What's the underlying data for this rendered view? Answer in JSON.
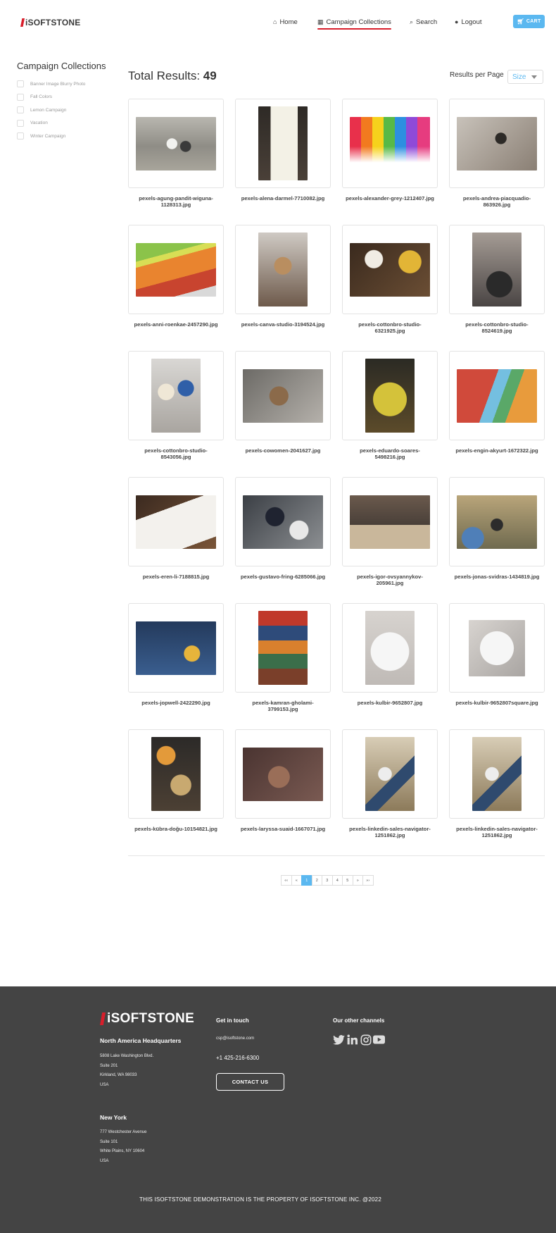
{
  "brand": {
    "name": "iSoftStone",
    "accent": "#d81e2b",
    "primary": "#5bb8f0",
    "footer_bg": "#444444"
  },
  "nav": {
    "home": "Home",
    "collections": "Campaign Collections",
    "search": "Search",
    "logout": "Logout",
    "cart": "CART",
    "icons": {
      "home": "home-icon",
      "collections": "collections-icon",
      "search": "search-icon",
      "logout": "user-icon",
      "cart": "cart-icon"
    }
  },
  "sidebar": {
    "title": "Campaign Collections",
    "filters": [
      "Banner Image Blurry Photo",
      "Fall Colors",
      "Lemon Campaign",
      "Vacation",
      "Winter Campaign"
    ]
  },
  "results": {
    "label": "Total Results:",
    "count": "49",
    "per_page_label": "Results per Page",
    "per_page_placeholder": "Size"
  },
  "items": [
    {
      "name": "pexels-agung-pandit-wiguna-1128313.jpg"
    },
    {
      "name": "pexels-alena-darmel-7710082.jpg"
    },
    {
      "name": "pexels-alexander-grey-1212407.jpg"
    },
    {
      "name": "pexels-andrea-piacquadio-863926.jpg"
    },
    {
      "name": "pexels-anni-roenkae-2457290.jpg"
    },
    {
      "name": "pexels-canva-studio-3194524.jpg"
    },
    {
      "name": "pexels-cottonbro-studio-6321925.jpg"
    },
    {
      "name": "pexels-cottonbro-studio-8524619.jpg"
    },
    {
      "name": "pexels-cottonbro-studio-8543056.jpg"
    },
    {
      "name": "pexels-cowomen-2041627.jpg"
    },
    {
      "name": "pexels-eduardo-soares-5498216.jpg"
    },
    {
      "name": "pexels-engin-akyurt-1672322.jpg"
    },
    {
      "name": "pexels-eren-li-7188815.jpg"
    },
    {
      "name": "pexels-gustavo-fring-6285066.jpg"
    },
    {
      "name": "pexels-igor-ovsyannykov-205961.jpg"
    },
    {
      "name": "pexels-jonas-svidras-1434819.jpg"
    },
    {
      "name": "pexels-jopwell-2422290.jpg"
    },
    {
      "name": "pexels-kamran-gholami-3799153.jpg"
    },
    {
      "name": "pexels-kulbir-9652807.jpg"
    },
    {
      "name": "pexels-kulbir-9652807square.jpg"
    },
    {
      "name": "pexels-kübra-doğu-10154821.jpg"
    },
    {
      "name": "pexels-laryssa-suaid-1667071.jpg"
    },
    {
      "name": "pexels-linkedin-sales-navigator-1251862.jpg"
    },
    {
      "name": "pexels-linkedin-sales-navigator-1251862.jpg"
    }
  ],
  "pagination": {
    "first": "«‹",
    "prev": "«",
    "pages": [
      "1",
      "2",
      "3",
      "4",
      "5"
    ],
    "current": "1",
    "next": "»",
    "last": "»›"
  },
  "footer": {
    "hq_title": "North America Headquarters",
    "hq_address": [
      "5808 Lake Washington Blvd.",
      "Suite 201",
      "Kirkland, WA 98033",
      "USA"
    ],
    "ny_title": "New York",
    "ny_address": [
      "777 Westchester Avenue",
      "Suite 101",
      "White Plains, NY 10604",
      "USA"
    ],
    "get_in_touch": "Get in touch",
    "email": "csp@isoftstone.com",
    "phone": "+1 425-216-6300",
    "contact_button": "CONTACT US",
    "other_channels": "Our other channels",
    "social_icons": [
      "twitter-icon",
      "linkedin-icon",
      "instagram-icon",
      "youtube-icon"
    ],
    "copyright": "THIS ISOFTSTONE DEMONSTRATION IS THE PROPERTY OF ISOFTSTONE INC. @2022"
  }
}
